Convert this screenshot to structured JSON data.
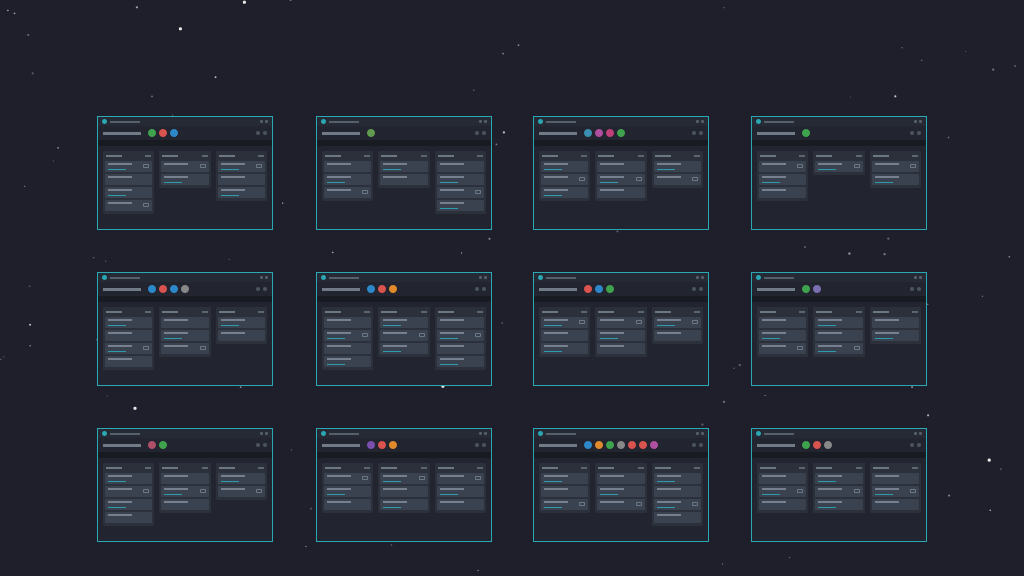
{
  "colors": {
    "background": "#1f1f2b",
    "frame": "#2aa8b3",
    "progress": "#2ab0c5"
  },
  "icons": {
    "board_logo": "trello-logo-icon",
    "avatar": "member-avatar-icon"
  },
  "boards": [
    {
      "members": [
        "#3fa34d",
        "#d9534f",
        "#2c88c9"
      ],
      "lists": [
        4,
        2,
        3
      ]
    },
    {
      "members": [
        "#5f9a4f"
      ],
      "lists": [
        3,
        2,
        4
      ]
    },
    {
      "members": [
        "#3a8fb0",
        "#b04fa0",
        "#c0407a",
        "#3fa34d"
      ],
      "lists": [
        3,
        3,
        2
      ]
    },
    {
      "members": [
        "#3fa34d"
      ],
      "lists": [
        3,
        1,
        2
      ]
    },
    {
      "members": [
        "#2c88c9",
        "#d9534f",
        "#2c88c9",
        "#888888"
      ],
      "lists": [
        4,
        3,
        2
      ]
    },
    {
      "members": [
        "#2c88c9",
        "#d9534f",
        "#e08a2c"
      ],
      "lists": [
        4,
        3,
        4
      ]
    },
    {
      "members": [
        "#d9534f",
        "#2c88c9",
        "#3fa34d"
      ],
      "lists": [
        3,
        3,
        2
      ]
    },
    {
      "members": [
        "#3fa34d",
        "#7a6fb0"
      ],
      "lists": [
        3,
        3,
        2
      ]
    },
    {
      "members": [
        "#b04f6a",
        "#3fa34d"
      ],
      "lists": [
        4,
        3,
        2
      ]
    },
    {
      "members": [
        "#7a4fb0",
        "#d9534f",
        "#e08a2c"
      ],
      "lists": [
        3,
        3,
        3
      ]
    },
    {
      "members": [
        "#2c88c9",
        "#e08a2c",
        "#3fa34d",
        "#888888",
        "#d9534f",
        "#d9534f",
        "#b04fa0"
      ],
      "lists": [
        3,
        3,
        4
      ]
    },
    {
      "members": [
        "#3fa34d",
        "#d9534f",
        "#888888"
      ],
      "lists": [
        3,
        3,
        3
      ]
    }
  ]
}
